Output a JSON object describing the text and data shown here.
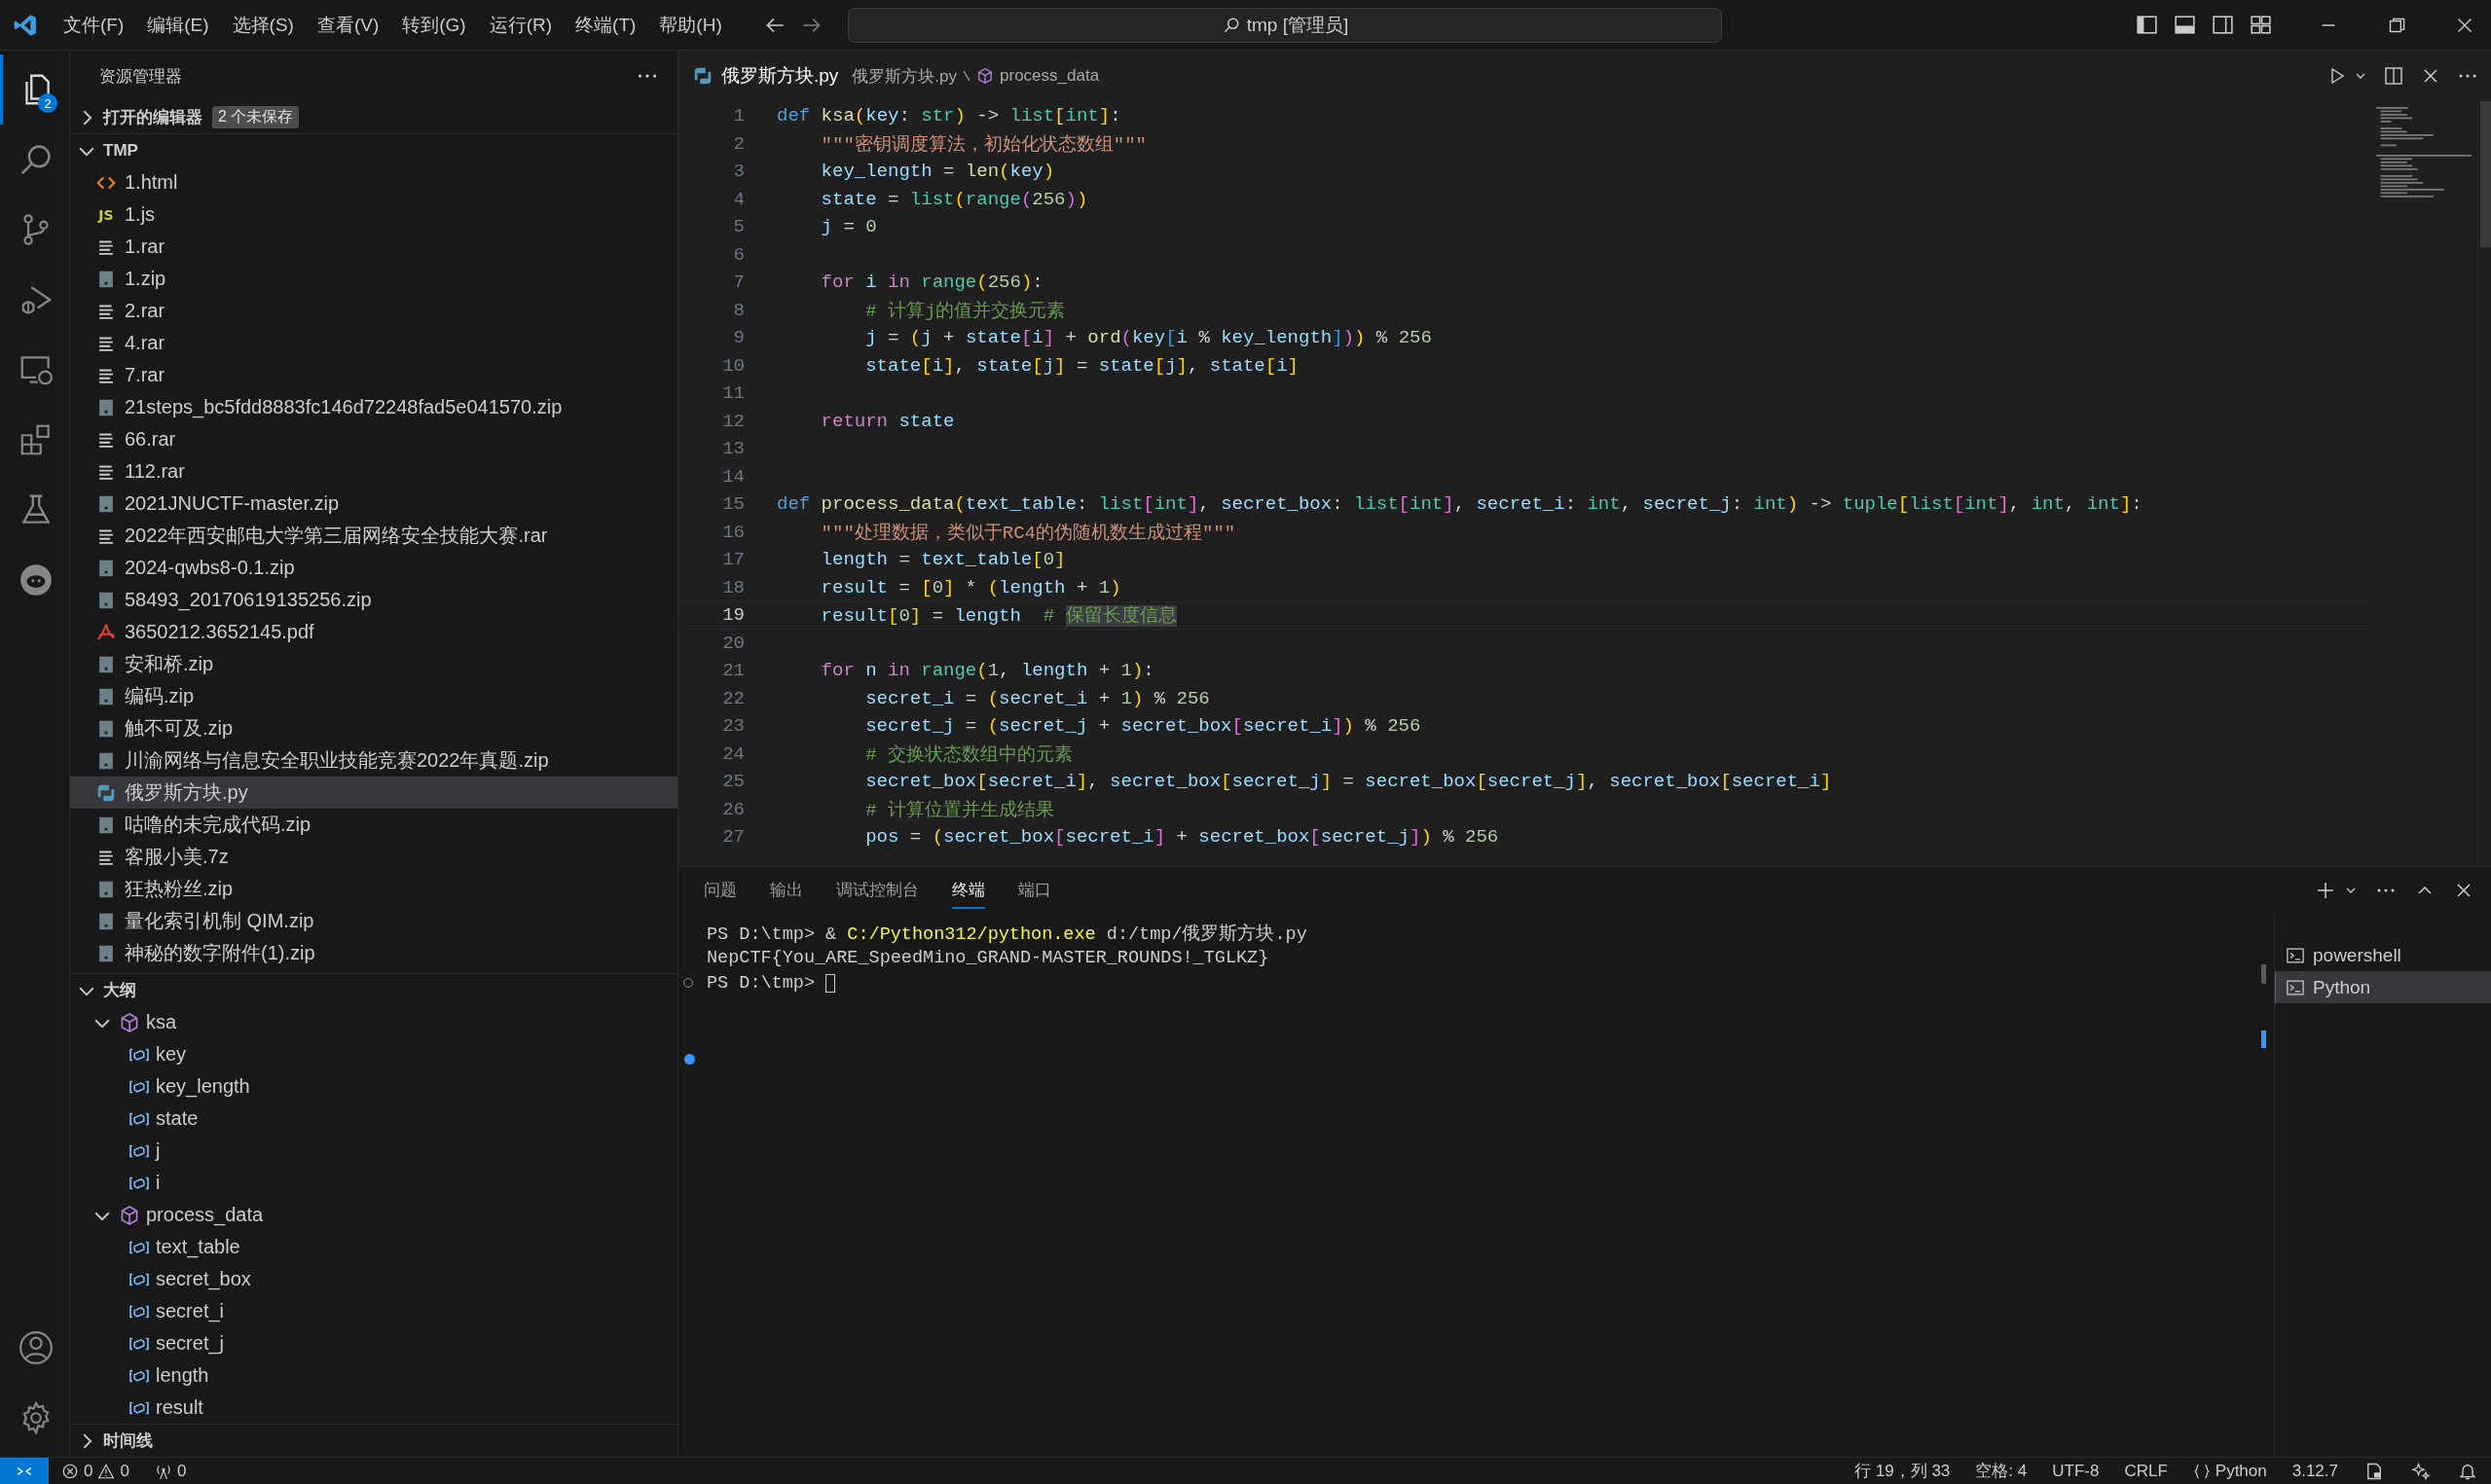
{
  "title_bar": {
    "menus": [
      "文件(F)",
      "编辑(E)",
      "选择(S)",
      "查看(V)",
      "转到(G)",
      "运行(R)",
      "终端(T)",
      "帮助(H)"
    ],
    "command_center": "tmp [管理员]"
  },
  "activity_bar": {
    "items": [
      {
        "kind": "files",
        "selected": true,
        "badge": "2"
      },
      {
        "kind": "search",
        "selected": false
      },
      {
        "kind": "source-control",
        "selected": false
      },
      {
        "kind": "run-debug",
        "selected": false
      },
      {
        "kind": "remote",
        "selected": false
      },
      {
        "kind": "extensions",
        "selected": false
      },
      {
        "kind": "testing",
        "selected": false
      },
      {
        "kind": "blob",
        "selected": false
      }
    ],
    "bottom": [
      {
        "kind": "account"
      },
      {
        "kind": "settings"
      }
    ]
  },
  "sidebar": {
    "title": "资源管理器",
    "open_editors": {
      "label": "打开的编辑器",
      "expanded": false,
      "badge": "2 个未保存"
    },
    "folder": {
      "label": "TMP",
      "expanded": true,
      "files": [
        {
          "name": "1.html",
          "kind": "html",
          "selected": false
        },
        {
          "name": "1.js",
          "kind": "js",
          "icon_text": "JS",
          "selected": false
        },
        {
          "name": "1.rar",
          "kind": "lines",
          "selected": false
        },
        {
          "name": "1.zip",
          "kind": "archive",
          "selected": false
        },
        {
          "name": "2.rar",
          "kind": "lines",
          "selected": false
        },
        {
          "name": "4.rar",
          "kind": "lines",
          "selected": false
        },
        {
          "name": "7.rar",
          "kind": "lines",
          "selected": false
        },
        {
          "name": "21steps_bc5fdd8883fc146d72248fad5e041570.zip",
          "kind": "archive",
          "selected": false
        },
        {
          "name": "66.rar",
          "kind": "lines",
          "selected": false
        },
        {
          "name": "112.rar",
          "kind": "lines",
          "selected": false
        },
        {
          "name": "2021JNUCTF-master.zip",
          "kind": "archive",
          "selected": false
        },
        {
          "name": "2022年西安邮电大学第三届网络安全技能大赛.rar",
          "kind": "lines",
          "selected": false
        },
        {
          "name": "2024-qwbs8-0.1.zip",
          "kind": "archive",
          "selected": false
        },
        {
          "name": "58493_20170619135256.zip",
          "kind": "archive",
          "selected": false
        },
        {
          "name": "3650212.3652145.pdf",
          "kind": "pdf",
          "selected": false
        },
        {
          "name": "安和桥.zip",
          "kind": "archive",
          "selected": false
        },
        {
          "name": "编码.zip",
          "kind": "archive",
          "selected": false
        },
        {
          "name": "触不可及.zip",
          "kind": "archive",
          "selected": false
        },
        {
          "name": "川渝网络与信息安全职业技能竞赛2022年真题.zip",
          "kind": "archive",
          "selected": false
        },
        {
          "name": "俄罗斯方块.py",
          "kind": "python",
          "selected": true
        },
        {
          "name": "咕噜的未完成代码.zip",
          "kind": "archive",
          "selected": false
        },
        {
          "name": "客服小美.7z",
          "kind": "lines",
          "selected": false
        },
        {
          "name": "狂热粉丝.zip",
          "kind": "archive",
          "selected": false
        },
        {
          "name": "量化索引机制 QIM.zip",
          "kind": "archive",
          "selected": false
        },
        {
          "name": "神秘的数字附件(1).zip",
          "kind": "archive",
          "selected": false
        }
      ]
    },
    "outline": {
      "label": "大纲",
      "expanded": true,
      "items": [
        {
          "name": "ksa",
          "kind": "function",
          "expanded": true,
          "children": [
            {
              "name": "key",
              "kind": "variable"
            },
            {
              "name": "key_length",
              "kind": "variable"
            },
            {
              "name": "state",
              "kind": "variable"
            },
            {
              "name": "j",
              "kind": "variable"
            },
            {
              "name": "i",
              "kind": "variable"
            }
          ]
        },
        {
          "name": "process_data",
          "kind": "function",
          "expanded": true,
          "children": [
            {
              "name": "text_table",
              "kind": "variable"
            },
            {
              "name": "secret_box",
              "kind": "variable"
            },
            {
              "name": "secret_i",
              "kind": "variable"
            },
            {
              "name": "secret_j",
              "kind": "variable"
            },
            {
              "name": "length",
              "kind": "variable"
            },
            {
              "name": "result",
              "kind": "variable"
            }
          ]
        }
      ]
    },
    "timeline": {
      "label": "时间线",
      "expanded": false
    }
  },
  "editor": {
    "tab": "俄罗斯方块.py",
    "breadcrumbs": [
      "俄罗斯方块.py",
      "process_data"
    ],
    "lines": [
      {
        "number": "1",
        "current": false,
        "tokens": [
          {
            "text": "def ",
            "kind": "keyword"
          },
          {
            "text": "ksa",
            "kind": "function"
          },
          {
            "text": "(",
            "kind": "bracket1"
          },
          {
            "text": "key",
            "kind": "variable"
          },
          {
            "text": ": ",
            "kind": "plain"
          },
          {
            "text": "str",
            "kind": "type"
          },
          {
            "text": ")",
            "kind": "bracket1"
          },
          {
            "text": " -> ",
            "kind": "plain"
          },
          {
            "text": "list",
            "kind": "type"
          },
          {
            "text": "[",
            "kind": "bracket1"
          },
          {
            "text": "int",
            "kind": "type"
          },
          {
            "text": "]",
            "kind": "bracket1"
          },
          {
            "text": ":",
            "kind": "plain"
          }
        ]
      },
      {
        "number": "2",
        "current": false,
        "tokens": [
          {
            "text": "    \"\"\"密钥调度算法，初始化状态数组\"\"\"",
            "kind": "string"
          }
        ]
      },
      {
        "number": "3",
        "current": false,
        "tokens": [
          {
            "text": "    key_length",
            "kind": "variable"
          },
          {
            "text": " = ",
            "kind": "plain"
          },
          {
            "text": "len",
            "kind": "function"
          },
          {
            "text": "(",
            "kind": "bracket1"
          },
          {
            "text": "key",
            "kind": "variable"
          },
          {
            "text": ")",
            "kind": "bracket1"
          }
        ]
      },
      {
        "number": "4",
        "current": false,
        "tokens": [
          {
            "text": "    state",
            "kind": "variable"
          },
          {
            "text": " = ",
            "kind": "plain"
          },
          {
            "text": "list",
            "kind": "type"
          },
          {
            "text": "(",
            "kind": "bracket1"
          },
          {
            "text": "range",
            "kind": "type"
          },
          {
            "text": "(",
            "kind": "bracket2"
          },
          {
            "text": "256",
            "kind": "number"
          },
          {
            "text": ")",
            "kind": "bracket2"
          },
          {
            "text": ")",
            "kind": "bracket1"
          }
        ]
      },
      {
        "number": "5",
        "current": false,
        "tokens": [
          {
            "text": "    j",
            "kind": "variable"
          },
          {
            "text": " = ",
            "kind": "plain"
          },
          {
            "text": "0",
            "kind": "number"
          }
        ]
      },
      {
        "number": "6",
        "current": false
      },
      {
        "number": "7",
        "current": false,
        "tokens": [
          {
            "text": "    for ",
            "kind": "control"
          },
          {
            "text": "i ",
            "kind": "variable"
          },
          {
            "text": "in ",
            "kind": "control"
          },
          {
            "text": "range",
            "kind": "type"
          },
          {
            "text": "(",
            "kind": "bracket1"
          },
          {
            "text": "256",
            "kind": "number"
          },
          {
            "text": ")",
            "kind": "bracket1"
          },
          {
            "text": ":",
            "kind": "plain"
          }
        ]
      },
      {
        "number": "8",
        "current": false,
        "tokens": [
          {
            "text": "        # 计算j的值并交换元素",
            "kind": "comment"
          }
        ]
      },
      {
        "number": "9",
        "current": false,
        "tokens": [
          {
            "text": "        j",
            "kind": "variable"
          },
          {
            "text": " = ",
            "kind": "plain"
          },
          {
            "text": "(",
            "kind": "bracket1"
          },
          {
            "text": "j",
            "kind": "variable"
          },
          {
            "text": " + ",
            "kind": "plain"
          },
          {
            "text": "state",
            "kind": "variable"
          },
          {
            "text": "[",
            "kind": "bracket2"
          },
          {
            "text": "i",
            "kind": "variable"
          },
          {
            "text": "]",
            "kind": "bracket2"
          },
          {
            "text": " + ",
            "kind": "plain"
          },
          {
            "text": "ord",
            "kind": "function"
          },
          {
            "text": "(",
            "kind": "bracket2"
          },
          {
            "text": "key",
            "kind": "variable"
          },
          {
            "text": "[",
            "kind": "bracket3"
          },
          {
            "text": "i",
            "kind": "variable"
          },
          {
            "text": " % ",
            "kind": "plain"
          },
          {
            "text": "key_length",
            "kind": "variable"
          },
          {
            "text": "]",
            "kind": "bracket3"
          },
          {
            "text": ")",
            "kind": "bracket2"
          },
          {
            "text": ")",
            "kind": "bracket1"
          },
          {
            "text": " % ",
            "kind": "plain"
          },
          {
            "text": "256",
            "kind": "number"
          }
        ]
      },
      {
        "number": "10",
        "current": false,
        "tokens": [
          {
            "text": "        state",
            "kind": "variable"
          },
          {
            "text": "[",
            "kind": "bracket1"
          },
          {
            "text": "i",
            "kind": "variable"
          },
          {
            "text": "]",
            "kind": "bracket1"
          },
          {
            "text": ", ",
            "kind": "plain"
          },
          {
            "text": "state",
            "kind": "variable"
          },
          {
            "text": "[",
            "kind": "bracket1"
          },
          {
            "text": "j",
            "kind": "variable"
          },
          {
            "text": "]",
            "kind": "bracket1"
          },
          {
            "text": " = ",
            "kind": "plain"
          },
          {
            "text": "state",
            "kind": "variable"
          },
          {
            "text": "[",
            "kind": "bracket1"
          },
          {
            "text": "j",
            "kind": "variable"
          },
          {
            "text": "]",
            "kind": "bracket1"
          },
          {
            "text": ", ",
            "kind": "plain"
          },
          {
            "text": "state",
            "kind": "variable"
          },
          {
            "text": "[",
            "kind": "bracket1"
          },
          {
            "text": "i",
            "kind": "variable"
          },
          {
            "text": "]",
            "kind": "bracket1"
          }
        ]
      },
      {
        "number": "11",
        "current": false
      },
      {
        "number": "12",
        "current": false,
        "tokens": [
          {
            "text": "    return ",
            "kind": "control"
          },
          {
            "text": "state",
            "kind": "variable"
          }
        ]
      },
      {
        "number": "13",
        "current": false
      },
      {
        "number": "14",
        "current": false
      },
      {
        "number": "15",
        "current": false,
        "tokens": [
          {
            "text": "def ",
            "kind": "keyword"
          },
          {
            "text": "process_data",
            "kind": "function"
          },
          {
            "text": "(",
            "kind": "bracket1"
          },
          {
            "text": "text_table",
            "kind": "variable"
          },
          {
            "text": ": ",
            "kind": "plain"
          },
          {
            "text": "list",
            "kind": "type"
          },
          {
            "text": "[",
            "kind": "bracket2"
          },
          {
            "text": "int",
            "kind": "type"
          },
          {
            "text": "]",
            "kind": "bracket2"
          },
          {
            "text": ", ",
            "kind": "plain"
          },
          {
            "text": "secret_box",
            "kind": "variable"
          },
          {
            "text": ": ",
            "kind": "plain"
          },
          {
            "text": "list",
            "kind": "type"
          },
          {
            "text": "[",
            "kind": "bracket2"
          },
          {
            "text": "int",
            "kind": "type"
          },
          {
            "text": "]",
            "kind": "bracket2"
          },
          {
            "text": ", ",
            "kind": "plain"
          },
          {
            "text": "secret_i",
            "kind": "variable"
          },
          {
            "text": ": ",
            "kind": "plain"
          },
          {
            "text": "int",
            "kind": "type"
          },
          {
            "text": ", ",
            "kind": "plain"
          },
          {
            "text": "secret_j",
            "kind": "variable"
          },
          {
            "text": ": ",
            "kind": "plain"
          },
          {
            "text": "int",
            "kind": "type"
          },
          {
            "text": ")",
            "kind": "bracket1"
          },
          {
            "text": " -> ",
            "kind": "plain"
          },
          {
            "text": "tuple",
            "kind": "type"
          },
          {
            "text": "[",
            "kind": "bracket1"
          },
          {
            "text": "list",
            "kind": "type"
          },
          {
            "text": "[",
            "kind": "bracket2"
          },
          {
            "text": "int",
            "kind": "type"
          },
          {
            "text": "]",
            "kind": "bracket2"
          },
          {
            "text": ", ",
            "kind": "plain"
          },
          {
            "text": "int",
            "kind": "type"
          },
          {
            "text": ", ",
            "kind": "plain"
          },
          {
            "text": "int",
            "kind": "type"
          },
          {
            "text": "]",
            "kind": "bracket1"
          },
          {
            "text": ":",
            "kind": "plain"
          }
        ]
      },
      {
        "number": "16",
        "current": false,
        "tokens": [
          {
            "text": "    \"\"\"处理数据，类似于RC4的伪随机数生成过程\"\"\"",
            "kind": "string"
          }
        ]
      },
      {
        "number": "17",
        "current": false,
        "tokens": [
          {
            "text": "    length",
            "kind": "variable"
          },
          {
            "text": " = ",
            "kind": "plain"
          },
          {
            "text": "text_table",
            "kind": "variable"
          },
          {
            "text": "[",
            "kind": "bracket1"
          },
          {
            "text": "0",
            "kind": "number"
          },
          {
            "text": "]",
            "kind": "bracket1"
          }
        ]
      },
      {
        "number": "18",
        "current": false,
        "tokens": [
          {
            "text": "    result",
            "kind": "variable"
          },
          {
            "text": " = ",
            "kind": "plain"
          },
          {
            "text": "[",
            "kind": "bracket1"
          },
          {
            "text": "0",
            "kind": "number"
          },
          {
            "text": "]",
            "kind": "bracket1"
          },
          {
            "text": " * ",
            "kind": "plain"
          },
          {
            "text": "(",
            "kind": "bracket1"
          },
          {
            "text": "length",
            "kind": "variable"
          },
          {
            "text": " + ",
            "kind": "plain"
          },
          {
            "text": "1",
            "kind": "number"
          },
          {
            "text": ")",
            "kind": "bracket1"
          }
        ]
      },
      {
        "number": "19",
        "current": true,
        "tokens": [
          {
            "text": "    result",
            "kind": "variable"
          },
          {
            "text": "[",
            "kind": "bracket1"
          },
          {
            "text": "0",
            "kind": "number"
          },
          {
            "text": "]",
            "kind": "bracket1"
          },
          {
            "text": " = ",
            "kind": "plain"
          },
          {
            "text": "length",
            "kind": "variable"
          },
          {
            "text": "  # ",
            "kind": "comment"
          },
          {
            "text": "保留长度信息",
            "kind": "selected-comment"
          }
        ]
      },
      {
        "number": "20",
        "current": false
      },
      {
        "number": "21",
        "current": false,
        "tokens": [
          {
            "text": "    for ",
            "kind": "control"
          },
          {
            "text": "n ",
            "kind": "variable"
          },
          {
            "text": "in ",
            "kind": "control"
          },
          {
            "text": "range",
            "kind": "type"
          },
          {
            "text": "(",
            "kind": "bracket1"
          },
          {
            "text": "1",
            "kind": "number"
          },
          {
            "text": ", ",
            "kind": "plain"
          },
          {
            "text": "length",
            "kind": "variable"
          },
          {
            "text": " + ",
            "kind": "plain"
          },
          {
            "text": "1",
            "kind": "number"
          },
          {
            "text": ")",
            "kind": "bracket1"
          },
          {
            "text": ":",
            "kind": "plain"
          }
        ]
      },
      {
        "number": "22",
        "current": false,
        "tokens": [
          {
            "text": "        secret_i",
            "kind": "variable"
          },
          {
            "text": " = ",
            "kind": "plain"
          },
          {
            "text": "(",
            "kind": "bracket1"
          },
          {
            "text": "secret_i",
            "kind": "variable"
          },
          {
            "text": " + ",
            "kind": "plain"
          },
          {
            "text": "1",
            "kind": "number"
          },
          {
            "text": ")",
            "kind": "bracket1"
          },
          {
            "text": " % ",
            "kind": "plain"
          },
          {
            "text": "256",
            "kind": "number"
          }
        ]
      },
      {
        "number": "23",
        "current": false,
        "tokens": [
          {
            "text": "        secret_j",
            "kind": "variable"
          },
          {
            "text": " = ",
            "kind": "plain"
          },
          {
            "text": "(",
            "kind": "bracket1"
          },
          {
            "text": "secret_j",
            "kind": "variable"
          },
          {
            "text": " + ",
            "kind": "plain"
          },
          {
            "text": "secret_box",
            "kind": "variable"
          },
          {
            "text": "[",
            "kind": "bracket2"
          },
          {
            "text": "secret_i",
            "kind": "variable"
          },
          {
            "text": "]",
            "kind": "bracket2"
          },
          {
            "text": ")",
            "kind": "bracket1"
          },
          {
            "text": " % ",
            "kind": "plain"
          },
          {
            "text": "256",
            "kind": "number"
          }
        ]
      },
      {
        "number": "24",
        "current": false,
        "tokens": [
          {
            "text": "        # 交换状态数组中的元素",
            "kind": "comment"
          }
        ]
      },
      {
        "number": "25",
        "current": false,
        "tokens": [
          {
            "text": "        secret_box",
            "kind": "variable"
          },
          {
            "text": "[",
            "kind": "bracket1"
          },
          {
            "text": "secret_i",
            "kind": "variable"
          },
          {
            "text": "]",
            "kind": "bracket1"
          },
          {
            "text": ", ",
            "kind": "plain"
          },
          {
            "text": "secret_box",
            "kind": "variable"
          },
          {
            "text": "[",
            "kind": "bracket1"
          },
          {
            "text": "secret_j",
            "kind": "variable"
          },
          {
            "text": "]",
            "kind": "bracket1"
          },
          {
            "text": " = ",
            "kind": "plain"
          },
          {
            "text": "secret_box",
            "kind": "variable"
          },
          {
            "text": "[",
            "kind": "bracket1"
          },
          {
            "text": "secret_j",
            "kind": "variable"
          },
          {
            "text": "]",
            "kind": "bracket1"
          },
          {
            "text": ", ",
            "kind": "plain"
          },
          {
            "text": "secret_box",
            "kind": "variable"
          },
          {
            "text": "[",
            "kind": "bracket1"
          },
          {
            "text": "secret_i",
            "kind": "variable"
          },
          {
            "text": "]",
            "kind": "bracket1"
          }
        ]
      },
      {
        "number": "26",
        "current": false,
        "tokens": [
          {
            "text": "        # 计算位置并生成结果",
            "kind": "comment"
          }
        ]
      },
      {
        "number": "27",
        "current": false,
        "tokens": [
          {
            "text": "        pos",
            "kind": "variable"
          },
          {
            "text": " = ",
            "kind": "plain"
          },
          {
            "text": "(",
            "kind": "bracket1"
          },
          {
            "text": "secret_box",
            "kind": "variable"
          },
          {
            "text": "[",
            "kind": "bracket2"
          },
          {
            "text": "secret_i",
            "kind": "variable"
          },
          {
            "text": "]",
            "kind": "bracket2"
          },
          {
            "text": " + ",
            "kind": "plain"
          },
          {
            "text": "secret_box",
            "kind": "variable"
          },
          {
            "text": "[",
            "kind": "bracket2"
          },
          {
            "text": "secret_j",
            "kind": "variable"
          },
          {
            "text": "]",
            "kind": "bracket2"
          },
          {
            "text": ")",
            "kind": "bracket1"
          },
          {
            "text": " % ",
            "kind": "plain"
          },
          {
            "text": "256",
            "kind": "number"
          }
        ]
      }
    ]
  },
  "panel": {
    "tabs": [
      {
        "label": "问题",
        "selected": false
      },
      {
        "label": "输出",
        "selected": false
      },
      {
        "label": "调试控制台",
        "selected": false
      },
      {
        "label": "终端",
        "selected": true
      },
      {
        "label": "端口",
        "selected": false
      }
    ],
    "terminal_lines": [
      {
        "segments": [
          {
            "text": "PS D:\\tmp> & ",
            "kind": "plain"
          },
          {
            "text": "C:/Python312/python.exe",
            "kind": "command"
          },
          {
            "text": " d:/tmp/俄罗斯方块.py",
            "kind": "plain"
          }
        ]
      },
      {
        "segments": [
          {
            "text": "NepCTF{You_ARE_SpeedMino_GRAND-MASTER_ROUNDS!_TGLKZ}",
            "kind": "plain"
          }
        ]
      },
      {
        "decoration": {
          "kind": "hollow"
        },
        "cursor": true,
        "segments": [
          {
            "text": "PS D:\\tmp> ",
            "kind": "plain"
          }
        ]
      },
      {
        "decoration": {
          "kind": "filled"
        }
      }
    ],
    "terminals": [
      {
        "name": "powershell",
        "selected": false
      },
      {
        "name": "Python",
        "selected": true
      }
    ]
  },
  "status_bar": {
    "errors": "0",
    "warnings": "0",
    "ports": "0",
    "items": [
      {
        "text": "行 19，列 33",
        "kind": "text"
      },
      {
        "text": "空格: 4",
        "kind": "text"
      },
      {
        "text": "UTF-8",
        "kind": "text"
      },
      {
        "text": "CRLF",
        "kind": "text"
      },
      {
        "text": "Python",
        "kind": "language"
      },
      {
        "text": "3.12.7",
        "kind": "text"
      }
    ]
  }
}
